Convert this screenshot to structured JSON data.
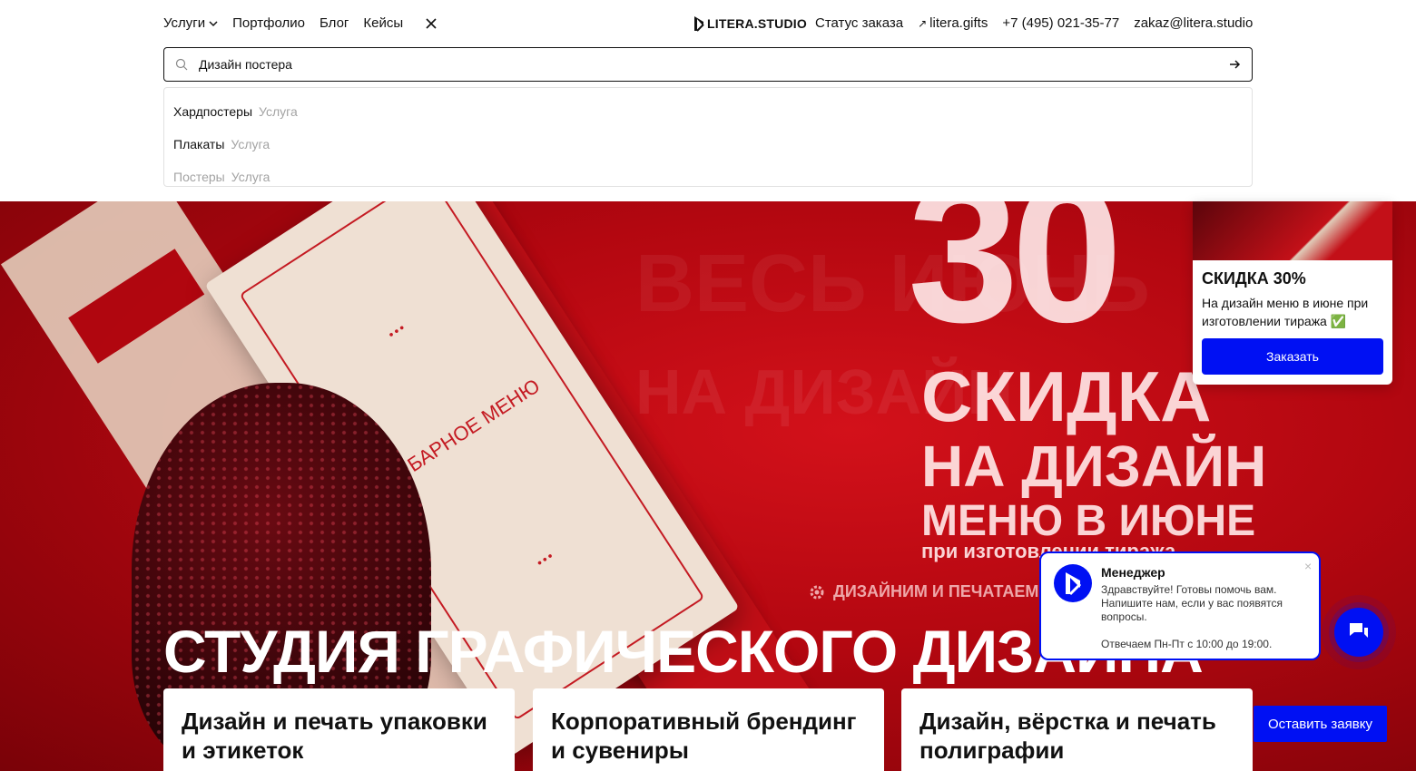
{
  "nav": {
    "services": "Услуги",
    "portfolio": "Портфолио",
    "blog": "Блог",
    "cases": "Кейсы",
    "logo": "LITERA.STUDIO",
    "order_status": "Статус заказа",
    "gifts": "litera.gifts",
    "phone": "+7 (495) 021-35-77",
    "email": "zakaz@litera.studio"
  },
  "search": {
    "value": "Дизайн постера"
  },
  "suggestions": [
    {
      "name": "Хардпостеры",
      "type": "Услуга"
    },
    {
      "name": "Плакаты",
      "type": "Услуга"
    },
    {
      "name": "Постеры",
      "type": "Услуга"
    }
  ],
  "hero": {
    "big_number": "30",
    "line1": "СКИДКА",
    "line2": "НА ДИЗАЙН",
    "line3": "МЕНЮ В ИЮНЕ",
    "line4": "при изготовлении тиража",
    "bg_text1": "ВЕСЬ ИЮНЬ",
    "bg_text2": "НА ДИЗАЙН",
    "tagline": "ДИЗАЙНИМ И ПЕЧАТАЕМ Н",
    "menu_label": "БАРНОЕ МЕНЮ",
    "title": "СТУДИЯ ГРАФИЧЕСКОГО ДИЗАЙНА"
  },
  "cards": [
    {
      "title": "Дизайн и печать упаковки и этикеток"
    },
    {
      "title": "Корпоративный брендинг и сувениры"
    },
    {
      "title": "Дизайн, вёрстка и печать полиграфии"
    }
  ],
  "promo": {
    "heading": "СКИДКА 30%",
    "text": "На дизайн меню в июне при изготовлении тиража ✅",
    "button": "Заказать"
  },
  "chat": {
    "name": "Менеджер",
    "message": "Здравствуйте! Готовы помочь вам. Напишите нам, если у вас появятся вопросы.",
    "hours": "Отвечаем Пн-Пт с 10:00 до 19:00.",
    "close": "×"
  },
  "cta": {
    "leave_request": "Оставить заявку"
  },
  "colors": {
    "accent": "#0010f3",
    "hero_red": "#c10e16"
  }
}
